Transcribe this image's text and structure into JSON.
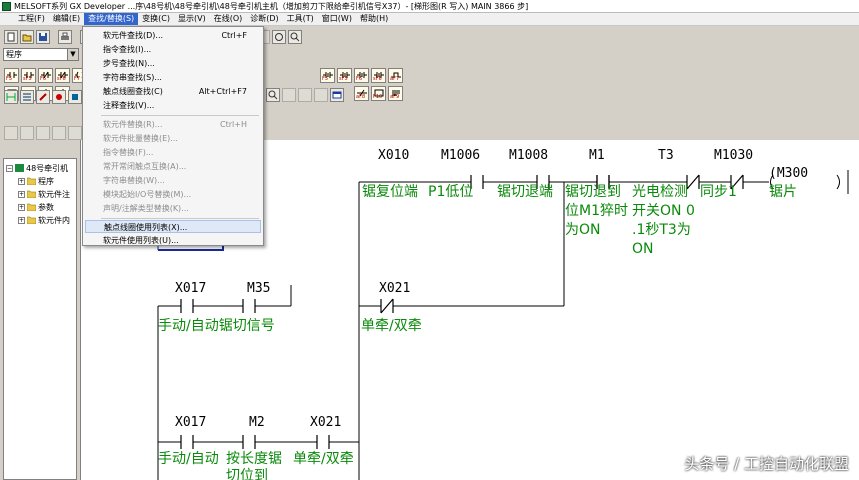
{
  "window": {
    "title": "MELSOFT系列 GX Developer ...序\\48号机\\48号牵引机\\48号牵引机主机（增加剪刀下限给牵引机信号X37）- [梯形图(R 写入)    MAIN    3866 步]"
  },
  "menubar": {
    "items": [
      "工程(F)",
      "编辑(E)",
      "查找/替换(S)",
      "变换(C)",
      "显示(V)",
      "在线(O)",
      "诊断(D)",
      "工具(T)",
      "窗口(W)",
      "帮助(H)"
    ]
  },
  "toolbar": {
    "combo_value": "程序",
    "fkeys_left": [
      "F5",
      "sF5",
      "F6",
      "sF6",
      "F7",
      "F8",
      "F9",
      "sF9",
      "cF9"
    ],
    "fkeys_right": [
      "F5",
      "sF5",
      "F6",
      "sF6",
      "aF7",
      "aF8",
      "F10",
      "aF9"
    ]
  },
  "tree": {
    "root": "48号牵引机",
    "items": [
      "程序",
      "软元件注",
      "参数",
      "软元件内"
    ]
  },
  "dropdown": {
    "items": [
      {
        "label": "软元件查找(D)...",
        "shortcut": "Ctrl+F",
        "enabled": true
      },
      {
        "label": "指令查找(I)...",
        "shortcut": "",
        "enabled": true
      },
      {
        "label": "步号查找(N)...",
        "shortcut": "",
        "enabled": true
      },
      {
        "label": "字符串查找(S)...",
        "shortcut": "",
        "enabled": true
      },
      {
        "label": "触点线圈查找(C)",
        "shortcut": "Alt+Ctrl+F7",
        "enabled": true
      },
      {
        "label": "注释查找(V)...",
        "shortcut": "",
        "enabled": true
      },
      {
        "label": "软元件替换(R)...",
        "shortcut": "Ctrl+H",
        "enabled": false
      },
      {
        "label": "软元件批量替换(E)...",
        "shortcut": "",
        "enabled": false
      },
      {
        "label": "指令替换(F)...",
        "shortcut": "",
        "enabled": false
      },
      {
        "label": "常开常闭触点互换(A)...",
        "shortcut": "",
        "enabled": false
      },
      {
        "label": "字符串替换(W)...",
        "shortcut": "",
        "enabled": false
      },
      {
        "label": "模块起始I/O号替换(M)...",
        "shortcut": "",
        "enabled": false
      },
      {
        "label": "声明/注解类型替换(K)...",
        "shortcut": "",
        "enabled": false
      },
      {
        "label": "触点线圈使用列表(X)...",
        "shortcut": "",
        "enabled": true,
        "highlighted": true
      },
      {
        "label": "软元件使用列表(U)...",
        "shortcut": "",
        "enabled": true
      }
    ]
  },
  "ladder": {
    "row1": {
      "devices": [
        "X010",
        "M1006",
        "M1008",
        "M1",
        "T3",
        "M1030"
      ],
      "coil": "M300",
      "comments": [
        [
          "锯复位端"
        ],
        [
          "P1低位"
        ],
        [
          "锯切退端"
        ],
        [
          "锯切退到",
          "位M1猝时",
          "为ON"
        ],
        [
          "光电检测",
          "开关ON 0",
          ".1秒T3为",
          "ON"
        ],
        [
          "同步1"
        ]
      ],
      "coil_comment": "锯片"
    },
    "row2": {
      "devices": [
        "X017",
        "M35",
        "X021"
      ],
      "comments": [
        "手动/自动锯切信号",
        "单牵/双牵"
      ]
    },
    "row3": {
      "devices": [
        "X017",
        "M2",
        "X021"
      ],
      "comments": [
        "手动/自动",
        "按长度锯",
        "单牵/双牵"
      ],
      "comment_line2": "切位到"
    }
  },
  "watermark": "头条号 / 工控自动化联盟"
}
